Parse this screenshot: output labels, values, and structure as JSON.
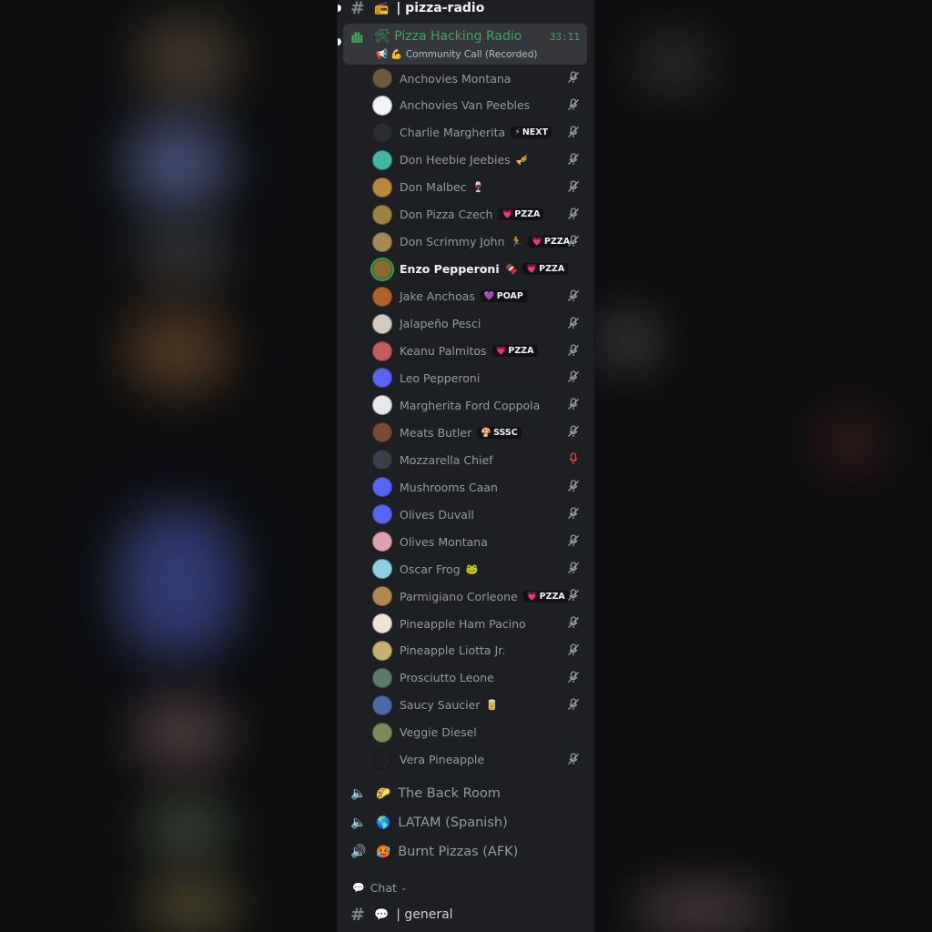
{
  "colors": {
    "panel": "#1e1f22",
    "active_voice": "#3ba55c",
    "muted_icon": "#949ba4",
    "live_mic": "#ed4245"
  },
  "top_channel": {
    "emoji": "📻",
    "name": "| pizza-radio"
  },
  "active_voice": {
    "icon": "voice-live-icon",
    "name": "🛠 Pizza Hacking Radio",
    "timer": "33:11",
    "subtitle": "📢 💪 Community Call (Recorded)"
  },
  "members": [
    {
      "name": "Anchovies Montana",
      "emoji": "",
      "tag": "",
      "tag_icon": "",
      "status": "muted",
      "avatar": "#6b5a3e"
    },
    {
      "name": "Anchovies Van Peebles",
      "emoji": "",
      "tag": "",
      "tag_icon": "",
      "status": "muted",
      "avatar": "#f2f3f5"
    },
    {
      "name": "Charlie Margherita",
      "emoji": "",
      "tag": "NEXT",
      "tag_icon": "⚡",
      "status": "muted",
      "avatar": "#2b2d31"
    },
    {
      "name": "Don Heebie Jeebies",
      "emoji": "🎺",
      "tag": "",
      "tag_icon": "",
      "status": "muted",
      "avatar": "#3fb8a0"
    },
    {
      "name": "Don Malbec",
      "emoji": "🍷",
      "tag": "",
      "tag_icon": "",
      "status": "muted",
      "avatar": "#b8893a"
    },
    {
      "name": "Don Pizza Czech",
      "emoji": "",
      "tag": "PZZA",
      "tag_icon": "💗",
      "status": "muted",
      "avatar": "#9c8440"
    },
    {
      "name": "Don Scrimmy John",
      "emoji": "🏃",
      "tag": "PZZA",
      "tag_icon": "💗",
      "status": "muted",
      "avatar": "#a68a55"
    },
    {
      "name": "Enzo Pepperoni",
      "emoji": "🍫",
      "tag": "PZZA",
      "tag_icon": "💗",
      "status": "speaking",
      "avatar": "#8a6a2e"
    },
    {
      "name": "Jake Anchoas",
      "emoji": "",
      "tag": "POAP",
      "tag_icon": "💜",
      "status": "muted",
      "avatar": "#b0622a"
    },
    {
      "name": "Jalapeño Pesci",
      "emoji": "",
      "tag": "",
      "tag_icon": "",
      "status": "muted",
      "avatar": "#d0cbc0"
    },
    {
      "name": "Keanu Palmitos",
      "emoji": "",
      "tag": "PZZA",
      "tag_icon": "💗",
      "status": "muted",
      "avatar": "#c45c5c"
    },
    {
      "name": "Leo Pepperoni",
      "emoji": "",
      "tag": "",
      "tag_icon": "",
      "status": "muted",
      "avatar": "#5865f2"
    },
    {
      "name": "Margherita Ford Coppola",
      "emoji": "",
      "tag": "",
      "tag_icon": "",
      "status": "muted",
      "avatar": "#e8e8e8"
    },
    {
      "name": "Meats Butler",
      "emoji": "",
      "tag": "SSSC",
      "tag_icon": "🍄",
      "status": "muted",
      "avatar": "#7a4a32"
    },
    {
      "name": "Mozzarella Chief",
      "emoji": "",
      "tag": "",
      "tag_icon": "",
      "status": "live-mic",
      "avatar": "#3a3f4a"
    },
    {
      "name": "Mushrooms Caan",
      "emoji": "",
      "tag": "",
      "tag_icon": "",
      "status": "muted",
      "avatar": "#5865f2"
    },
    {
      "name": "Olives Duvall",
      "emoji": "",
      "tag": "",
      "tag_icon": "",
      "status": "muted",
      "avatar": "#5865f2"
    },
    {
      "name": "Olives Montana",
      "emoji": "",
      "tag": "",
      "tag_icon": "",
      "status": "muted",
      "avatar": "#e0a0b0"
    },
    {
      "name": "Oscar Frog",
      "emoji": "🐸",
      "tag": "",
      "tag_icon": "",
      "status": "muted",
      "avatar": "#8fd0e0"
    },
    {
      "name": "Parmigiano Corleone",
      "emoji": "",
      "tag": "PZZA",
      "tag_icon": "💗",
      "status": "muted",
      "avatar": "#b08850"
    },
    {
      "name": "Pineapple Ham Pacino",
      "emoji": "",
      "tag": "",
      "tag_icon": "",
      "status": "muted",
      "avatar": "#f0e6d8"
    },
    {
      "name": "Pineapple Liotta Jr.",
      "emoji": "",
      "tag": "",
      "tag_icon": "",
      "status": "muted",
      "avatar": "#c8b070"
    },
    {
      "name": "Prosciutto Leone",
      "emoji": "",
      "tag": "",
      "tag_icon": "",
      "status": "muted",
      "avatar": "#5f7a6a"
    },
    {
      "name": "Saucy Saucier",
      "emoji": "🥫",
      "tag": "",
      "tag_icon": "",
      "status": "muted",
      "avatar": "#4a6aa8"
    },
    {
      "name": "Veggie Diesel",
      "emoji": "",
      "tag": "",
      "tag_icon": "",
      "status": "none",
      "avatar": "#7a8a5a"
    },
    {
      "name": "Vera Pineapple",
      "emoji": "",
      "tag": "",
      "tag_icon": "",
      "status": "muted",
      "avatar": "#1e1f22"
    }
  ],
  "voice_channels": [
    {
      "icon": "speaker-locked-icon",
      "emoji": "🌮",
      "name": "The Back Room"
    },
    {
      "icon": "speaker-locked-icon",
      "emoji": "🌎",
      "name": "LATAM (Spanish)"
    },
    {
      "icon": "speaker-icon",
      "emoji": "🥵",
      "name": "Burnt Pizzas (AFK)"
    }
  ],
  "category": {
    "emoji": "💬",
    "label": "Chat",
    "chevron": "⌄"
  },
  "bottom_channel": {
    "emoji": "💬",
    "name": "| general"
  }
}
